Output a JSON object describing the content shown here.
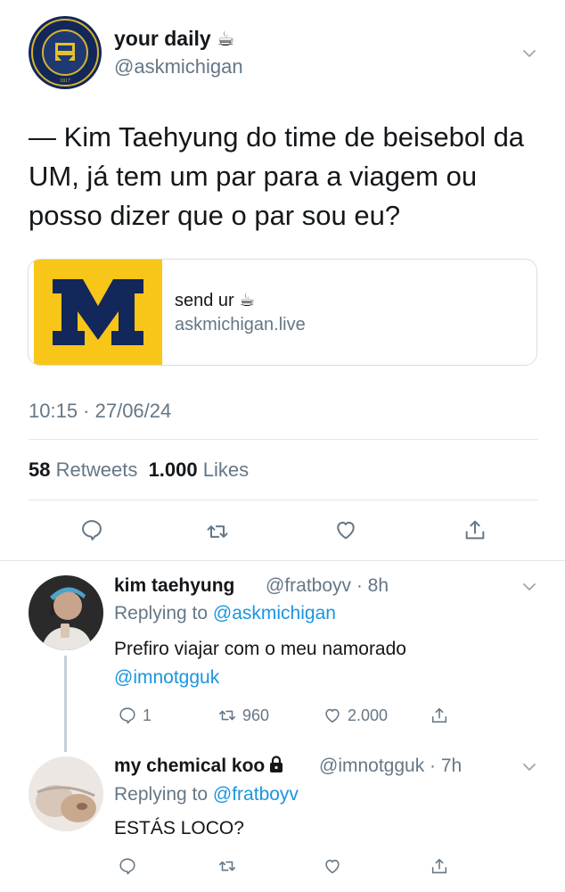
{
  "main_tweet": {
    "display_name": "your daily ☕",
    "handle": "@askmichigan",
    "text": "— Kim Taehyung do time de beisebol da UM, já tem um par para a viagem ou posso dizer que o par sou eu?",
    "card": {
      "title": "send ur ☕",
      "url": "askmichigan.live"
    },
    "timestamp": "10:15 · 27/06/24",
    "retweets_count": "58",
    "retweets_label": "Retweets",
    "likes_count": "1.000",
    "likes_label": "Likes",
    "avatar_seal_text": "THE UNIVERSITY OF MICHIGAN 1817"
  },
  "replies": [
    {
      "display_name": "kim taehyung",
      "handle_time": "@fratboyv · 8h",
      "replying_prefix": "Replying to",
      "replying_to": "@askmichigan",
      "text_line1": "Prefiro viajar com o meu namorado",
      "text_mention": "@imnotgguk",
      "reply_count": "1",
      "retweet_count": "960",
      "like_count": "2.000"
    },
    {
      "display_name": "my chemical koo",
      "handle_time": "@imnotgguk · 7h",
      "replying_prefix": "Replying to",
      "replying_to": "@fratboyv",
      "text_line1": "ESTÁS LOCO?",
      "reply_count": "",
      "retweet_count": "",
      "like_count": ""
    }
  ],
  "colors": {
    "accent": "#1b95e0",
    "muted": "#657786",
    "text": "#14171a",
    "michigan_maize": "#f8c519",
    "michigan_blue": "#12275a"
  },
  "icons": [
    "chevron-down-icon",
    "reply-icon",
    "retweet-icon",
    "like-icon",
    "share-icon",
    "lock-icon"
  ]
}
